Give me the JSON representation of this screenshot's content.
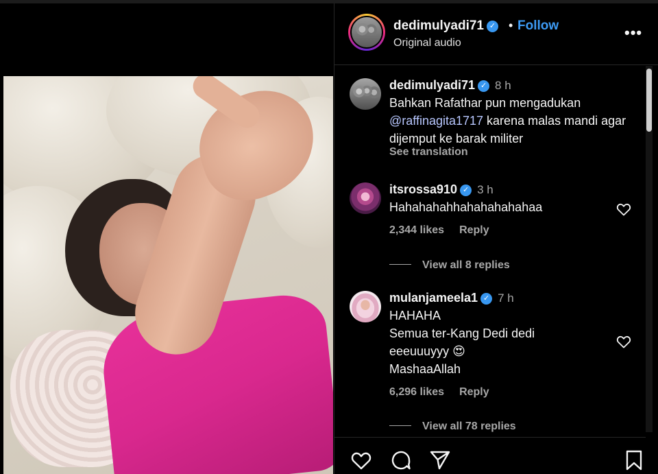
{
  "post": {
    "username": "dedimulyadi71",
    "separator": "•",
    "follow_label": "Follow",
    "audio_label": "Original audio",
    "more_label": "•••"
  },
  "comments": [
    {
      "username": "dedimulyadi71",
      "verified": true,
      "time": "8 h",
      "text_before": "Bahkan Rafathar pun mengadukan ",
      "mention": "@raffinagita1717",
      "text_after": " karena malas mandi agar dijemput ke barak militer",
      "translate_label": "See translation"
    },
    {
      "username": "itsrossa910",
      "verified": true,
      "time": "3 h",
      "text": "Hahahahahhahahahahahaa",
      "likes": "2,344 likes",
      "reply_label": "Reply",
      "view_replies": "View all 8 replies"
    },
    {
      "username": "mulanjameela1",
      "verified": true,
      "time": "7 h",
      "line1": "HAHAHA",
      "line2": "Semua ter-Kang Dedi dedi",
      "line3": "eeeuuuyyy 😍",
      "line4": "MashaaAllah",
      "likes": "6,296 likes",
      "reply_label": "Reply",
      "view_replies": "View all 78 replies"
    }
  ],
  "icons": {
    "verified": "verified-badge-icon",
    "like": "heart-icon",
    "comment": "comment-bubble-icon",
    "share": "paper-plane-icon",
    "save": "bookmark-icon",
    "more": "more-options-icon"
  },
  "colors": {
    "background": "#000000",
    "link_blue": "#3d9bf5",
    "verified_blue": "#3897f0",
    "secondary_text": "#a8a8a8",
    "divider": "#262626",
    "shirt_pink": "#e8319a"
  }
}
